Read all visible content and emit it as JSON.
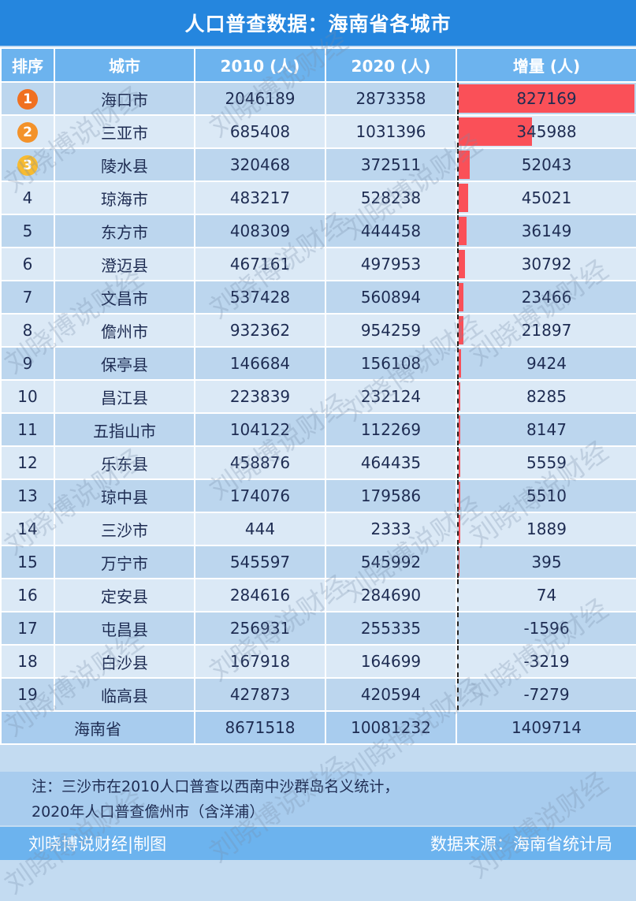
{
  "title": "人口普查数据：海南省各城市",
  "headers": {
    "rank": "排序",
    "city": "城市",
    "y2010": "2010 (人)",
    "y2020": "2020 (人)",
    "increase": "增量 (人)"
  },
  "colors": {
    "bar": "#fa5058",
    "header": "#2586de",
    "medal1": "#f07020",
    "medal2": "#f3922a",
    "medal3": "#f8bb30"
  },
  "chart_data": {
    "type": "table",
    "title": "人口普查数据：海南省各城市",
    "columns": [
      "排序",
      "城市",
      "2010 (人)",
      "2020 (人)",
      "增量 (人)"
    ],
    "rows": [
      {
        "rank": "1",
        "city": "海口市",
        "y2010": "2046189",
        "y2020": "2873358",
        "increase": 827169
      },
      {
        "rank": "2",
        "city": "三亚市",
        "y2010": "685408",
        "y2020": "1031396",
        "increase": 345988
      },
      {
        "rank": "3",
        "city": "陵水县",
        "y2010": "320468",
        "y2020": "372511",
        "increase": 52043
      },
      {
        "rank": "4",
        "city": "琼海市",
        "y2010": "483217",
        "y2020": "528238",
        "increase": 45021
      },
      {
        "rank": "5",
        "city": "东方市",
        "y2010": "408309",
        "y2020": "444458",
        "increase": 36149
      },
      {
        "rank": "6",
        "city": "澄迈县",
        "y2010": "467161",
        "y2020": "497953",
        "increase": 30792
      },
      {
        "rank": "7",
        "city": "文昌市",
        "y2010": "537428",
        "y2020": "560894",
        "increase": 23466
      },
      {
        "rank": "8",
        "city": "儋州市",
        "y2010": "932362",
        "y2020": "954259",
        "increase": 21897
      },
      {
        "rank": "9",
        "city": "保亭县",
        "y2010": "146684",
        "y2020": "156108",
        "increase": 9424
      },
      {
        "rank": "10",
        "city": "昌江县",
        "y2010": "223839",
        "y2020": "232124",
        "increase": 8285
      },
      {
        "rank": "11",
        "city": "五指山市",
        "y2010": "104122",
        "y2020": "112269",
        "increase": 8147
      },
      {
        "rank": "12",
        "city": "乐东县",
        "y2010": "458876",
        "y2020": "464435",
        "increase": 5559
      },
      {
        "rank": "13",
        "city": "琼中县",
        "y2010": "174076",
        "y2020": "179586",
        "increase": 5510
      },
      {
        "rank": "14",
        "city": "三沙市",
        "y2010": "444",
        "y2020": "2333",
        "increase": 1889
      },
      {
        "rank": "15",
        "city": "万宁市",
        "y2010": "545597",
        "y2020": "545992",
        "increase": 395
      },
      {
        "rank": "16",
        "city": "定安县",
        "y2010": "284616",
        "y2020": "284690",
        "increase": 74
      },
      {
        "rank": "17",
        "city": "屯昌县",
        "y2010": "256931",
        "y2020": "255335",
        "increase": -1596
      },
      {
        "rank": "18",
        "city": "白沙县",
        "y2010": "167918",
        "y2020": "164699",
        "increase": -3219
      },
      {
        "rank": "19",
        "city": "临高县",
        "y2010": "427873",
        "y2020": "420594",
        "increase": -7279
      }
    ],
    "total": {
      "city": "海南省",
      "y2010": "8671518",
      "y2020": "10081232",
      "increase": "1409714"
    },
    "bar_max": 827169
  },
  "note": {
    "line1": "注：三沙市在2010人口普查以西南中沙群岛名义统计，",
    "line2": "2020年人口普查儋州市（含洋浦）"
  },
  "footer": {
    "left": "刘晓博说财经|制图",
    "right": "数据来源：海南省统计局"
  },
  "watermark": "刘晓博说财经"
}
